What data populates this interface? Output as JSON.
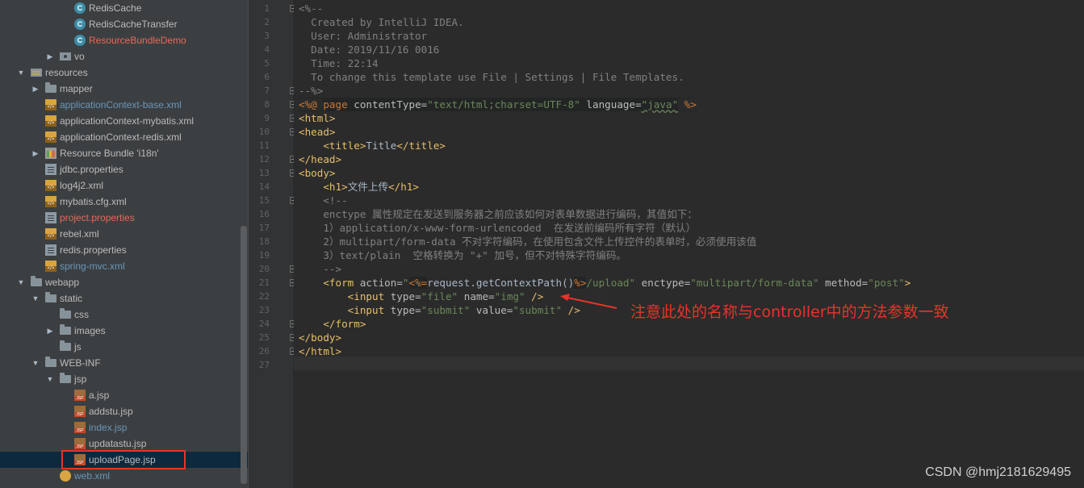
{
  "tree": {
    "items": [
      {
        "label": "RedisCache",
        "icon": "class-icon",
        "color": "default",
        "expand": ""
      },
      {
        "label": "RedisCacheTransfer",
        "icon": "class-icon",
        "color": "default",
        "expand": ""
      },
      {
        "label": "ResourceBundleDemo",
        "icon": "class-icon",
        "color": "red",
        "expand": ""
      },
      {
        "label": "vo",
        "icon": "package-folder-icon",
        "color": "default",
        "expand": "collapsed"
      },
      {
        "label": "resources",
        "icon": "resources-folder-icon",
        "color": "default",
        "expand": "expanded"
      },
      {
        "label": "mapper",
        "icon": "folder-icon",
        "color": "default",
        "expand": "collapsed"
      },
      {
        "label": "applicationContext-base.xml",
        "icon": "xml-file-icon",
        "color": "blue",
        "expand": ""
      },
      {
        "label": "applicationContext-mybatis.xml",
        "icon": "xml-file-icon",
        "color": "default",
        "expand": ""
      },
      {
        "label": "applicationContext-redis.xml",
        "icon": "xml-file-icon",
        "color": "default",
        "expand": ""
      },
      {
        "label": "Resource Bundle 'i18n'",
        "icon": "resource-bundle-icon",
        "color": "default",
        "expand": "collapsed"
      },
      {
        "label": "jdbc.properties",
        "icon": "properties-file-icon",
        "color": "default",
        "expand": ""
      },
      {
        "label": "log4j2.xml",
        "icon": "xml-file-icon",
        "color": "default",
        "expand": ""
      },
      {
        "label": "mybatis.cfg.xml",
        "icon": "xml-file-icon",
        "color": "default",
        "expand": ""
      },
      {
        "label": "project.properties",
        "icon": "properties-file-icon",
        "color": "red",
        "expand": ""
      },
      {
        "label": "rebel.xml",
        "icon": "xml-file-icon",
        "color": "default",
        "expand": ""
      },
      {
        "label": "redis.properties",
        "icon": "properties-file-icon",
        "color": "default",
        "expand": ""
      },
      {
        "label": "spring-mvc.xml",
        "icon": "xml-file-icon",
        "color": "blue",
        "expand": ""
      },
      {
        "label": "webapp",
        "icon": "folder-icon",
        "color": "default",
        "expand": "expanded"
      },
      {
        "label": "static",
        "icon": "folder-icon",
        "color": "default",
        "expand": "expanded"
      },
      {
        "label": "css",
        "icon": "folder-icon",
        "color": "default",
        "expand": ""
      },
      {
        "label": "images",
        "icon": "folder-icon",
        "color": "default",
        "expand": "collapsed"
      },
      {
        "label": "js",
        "icon": "folder-icon",
        "color": "default",
        "expand": ""
      },
      {
        "label": "WEB-INF",
        "icon": "folder-icon",
        "color": "default",
        "expand": "expanded"
      },
      {
        "label": "jsp",
        "icon": "folder-icon",
        "color": "default",
        "expand": "expanded"
      },
      {
        "label": "a.jsp",
        "icon": "jsp-file-icon",
        "color": "default",
        "expand": ""
      },
      {
        "label": "addstu.jsp",
        "icon": "jsp-file-icon",
        "color": "default",
        "expand": ""
      },
      {
        "label": "index.jsp",
        "icon": "jsp-file-icon",
        "color": "blue",
        "expand": ""
      },
      {
        "label": "updatastu.jsp",
        "icon": "jsp-file-icon",
        "color": "default",
        "expand": ""
      },
      {
        "label": "uploadPage.jsp",
        "icon": "jsp-file-icon",
        "color": "default",
        "expand": "",
        "selected": true
      },
      {
        "label": "web.xml",
        "icon": "web-xml-icon",
        "color": "blue",
        "expand": ""
      }
    ]
  },
  "editor": {
    "lines": [
      [
        [
          "comment",
          "<%--"
        ]
      ],
      [
        [
          "comment",
          "  Created by IntelliJ IDEA."
        ]
      ],
      [
        [
          "comment",
          "  User: Administrator"
        ]
      ],
      [
        [
          "comment",
          "  Date: 2019/11/16 0016"
        ]
      ],
      [
        [
          "comment",
          "  Time: 22:14"
        ]
      ],
      [
        [
          "comment",
          "  To change this template use File | Settings | File Templates."
        ]
      ],
      [
        [
          "comment",
          "--%>"
        ]
      ],
      [
        [
          "jspdir",
          "<%@ "
        ],
        [
          "jspkw",
          "page "
        ],
        [
          "attr",
          "contentType="
        ],
        [
          "str",
          "\"text/html;charset=UTF-8\""
        ],
        [
          "attr",
          " language="
        ],
        [
          "strul",
          "\"java\""
        ],
        [
          "jspdir",
          " %>"
        ]
      ],
      [
        [
          "tag",
          "<html>"
        ]
      ],
      [
        [
          "tag",
          "<head>"
        ]
      ],
      [
        [
          "text",
          "    "
        ],
        [
          "tag",
          "<title>"
        ],
        [
          "text",
          "Title"
        ],
        [
          "tag",
          "</title>"
        ]
      ],
      [
        [
          "tag",
          "</head>"
        ]
      ],
      [
        [
          "tag",
          "<body>"
        ]
      ],
      [
        [
          "text",
          "    "
        ],
        [
          "tag",
          "<h1>"
        ],
        [
          "text",
          "文件上传"
        ],
        [
          "tag",
          "</h1>"
        ]
      ],
      [
        [
          "comment",
          "    <!--"
        ]
      ],
      [
        [
          "comment",
          "    enctype 属性规定在发送到服务器之前应该如何对表单数据进行编码，其值如下："
        ]
      ],
      [
        [
          "comment",
          "    1）application/x-www-form-urlencoded  在发送前编码所有字符（默认）"
        ]
      ],
      [
        [
          "comment",
          "    2）multipart/form-data 不对字符编码，在使用包含文件上传控件的表单时，必须使用该值"
        ]
      ],
      [
        [
          "comment",
          "    3）text/plain  空格转换为 \"+\" 加号，但不对特殊字符编码。"
        ]
      ],
      [
        [
          "comment",
          "    -->"
        ]
      ],
      [
        [
          "text",
          "    "
        ],
        [
          "tag",
          "<form "
        ],
        [
          "attr",
          "action="
        ],
        [
          "str",
          "\""
        ],
        [
          "jspexpr",
          "<%="
        ],
        [
          "text",
          "request.getContextPath()"
        ],
        [
          "jspexpr",
          "%>"
        ],
        [
          "str",
          "/upload\""
        ],
        [
          "attr",
          " enctype="
        ],
        [
          "str",
          "\"multipart/form-data\""
        ],
        [
          "attr",
          " method="
        ],
        [
          "str",
          "\"post\""
        ],
        [
          "tag",
          ">"
        ]
      ],
      [
        [
          "text",
          "        "
        ],
        [
          "tag",
          "<input "
        ],
        [
          "attr",
          "type="
        ],
        [
          "str",
          "\"file\""
        ],
        [
          "attr",
          " name="
        ],
        [
          "str",
          "\"img\""
        ],
        [
          "tag",
          " />"
        ]
      ],
      [
        [
          "text",
          "        "
        ],
        [
          "tag",
          "<input "
        ],
        [
          "attr",
          "type="
        ],
        [
          "str",
          "\"submit\""
        ],
        [
          "attr",
          " value="
        ],
        [
          "str",
          "\"submit\""
        ],
        [
          "tag",
          " />"
        ]
      ],
      [
        [
          "text",
          "    "
        ],
        [
          "tag",
          "</form>"
        ]
      ],
      [
        [
          "tag",
          "</body>"
        ]
      ],
      [
        [
          "tag",
          "</html>"
        ]
      ],
      [
        [
          "text",
          ""
        ]
      ]
    ],
    "fold_lines": [
      1,
      7,
      8,
      9,
      10,
      12,
      13,
      15,
      20,
      21,
      24,
      25,
      26
    ]
  },
  "annotation": {
    "text": "注意此处的名称与controller中的方法参数一致",
    "color": "#e8332b"
  },
  "watermark": "CSDN @hmj2181629495",
  "colors": {
    "tree_bg": "#3c3f41",
    "editor_bg": "#2b2b2b",
    "gutter_bg": "#313335",
    "selection": "#0d293e",
    "highlight_box": "#e8332b"
  }
}
